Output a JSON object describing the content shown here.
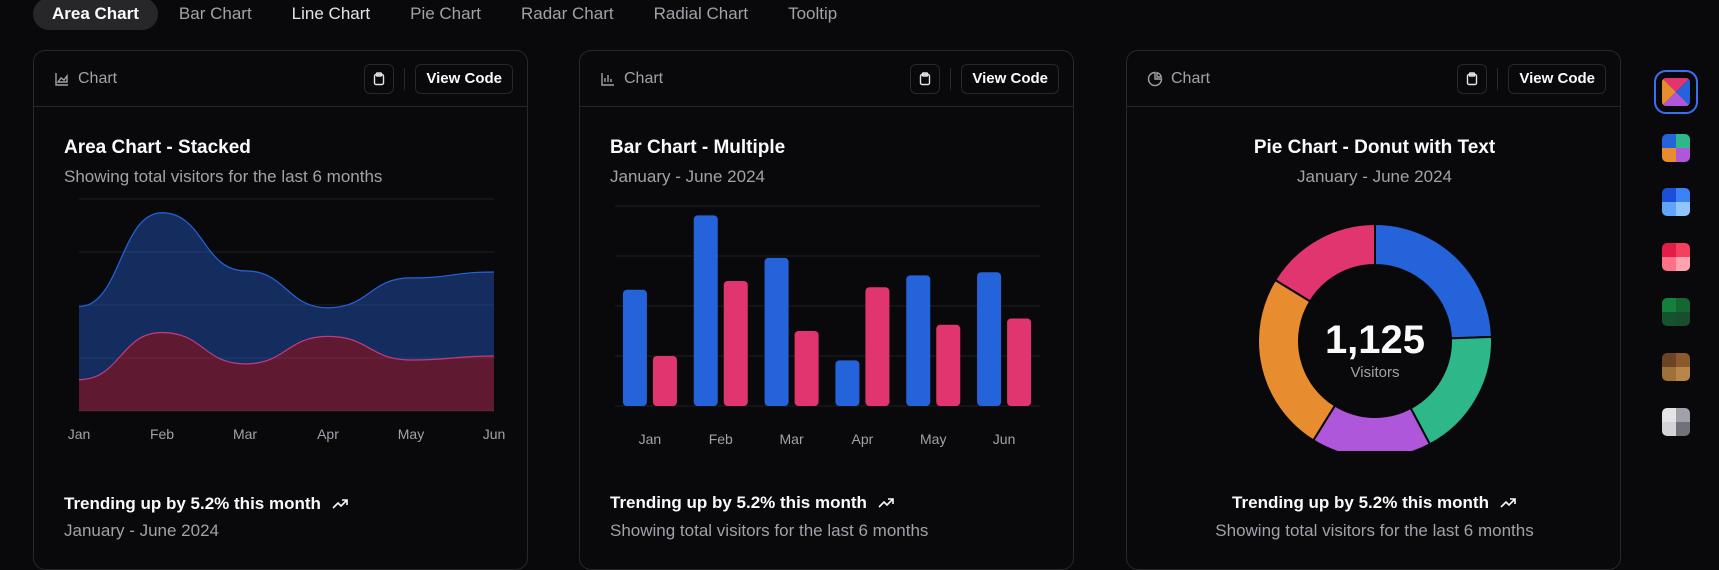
{
  "tabs": [
    {
      "label": "Area Chart",
      "active": true
    },
    {
      "label": "Bar Chart",
      "active": false
    },
    {
      "label": "Line Chart",
      "active": false
    },
    {
      "label": "Pie Chart",
      "active": false
    },
    {
      "label": "Radar Chart",
      "active": false
    },
    {
      "label": "Radial Chart",
      "active": false
    },
    {
      "label": "Tooltip",
      "active": false
    }
  ],
  "cards": [
    {
      "header_label": "Chart",
      "view_code_label": "View Code",
      "title": "Area Chart - Stacked",
      "subtitle": "Showing total visitors for the last 6 months",
      "footer_main": "Trending up by 5.2% this month",
      "footer_sub": "January - June 2024"
    },
    {
      "header_label": "Chart",
      "view_code_label": "View Code",
      "title": "Bar Chart - Multiple",
      "subtitle": "January - June 2024",
      "footer_main": "Trending up by 5.2% this month",
      "footer_sub": "Showing total visitors for the last 6 months"
    },
    {
      "header_label": "Chart",
      "view_code_label": "View Code",
      "title": "Pie Chart - Donut with Text",
      "subtitle": "January - June 2024",
      "footer_main": "Trending up by 5.2% this month",
      "footer_sub": "Showing total visitors for the last 6 months"
    }
  ],
  "colors": {
    "blue": "#2563db",
    "pink": "#e0356e",
    "green": "#2eb88a",
    "purple": "#af57db",
    "orange": "#e88c30"
  },
  "palette_swatches": [
    {
      "name": "mixed",
      "selected": true,
      "colors": [
        "#e0356e",
        "#2563db",
        "#e88c30",
        "#af57db"
      ]
    },
    {
      "name": "default",
      "selected": false,
      "colors": [
        "#2563db",
        "#2eb88a",
        "#e88c30",
        "#af57db"
      ]
    },
    {
      "name": "blue",
      "selected": false,
      "colors": [
        "#1d4ed8",
        "#3b82f6",
        "#60a5fa",
        "#93c5fd"
      ]
    },
    {
      "name": "rose",
      "selected": false,
      "colors": [
        "#e11d48",
        "#f43f5e",
        "#fb7185",
        "#fda4af"
      ]
    },
    {
      "name": "green",
      "selected": false,
      "colors": [
        "#15803d",
        "#166534",
        "#14532d",
        "#1a4d2e"
      ]
    },
    {
      "name": "brown",
      "selected": false,
      "colors": [
        "#6b4423",
        "#8b5a2b",
        "#a0703a",
        "#b8864b"
      ]
    },
    {
      "name": "neutral",
      "selected": false,
      "colors": [
        "#e4e4e7",
        "#a1a1aa",
        "#d4d4d8",
        "#71717a"
      ]
    }
  ],
  "chart_data": [
    {
      "type": "area",
      "title": "Area Chart - Stacked",
      "categories": [
        "Jan",
        "Feb",
        "Mar",
        "Apr",
        "May",
        "Jun"
      ],
      "series": [
        {
          "name": "",
          "color": "#e0356e",
          "values": [
            80,
            200,
            120,
            190,
            130,
            140
          ]
        },
        {
          "name": "",
          "color": "#2563db",
          "values": [
            186,
            305,
            237,
            73,
            209,
            214
          ]
        }
      ],
      "stacked": true,
      "ylim": [
        0,
        540
      ],
      "grid": true
    },
    {
      "type": "bar",
      "title": "Bar Chart - Multiple",
      "categories": [
        "Jan",
        "Feb",
        "Mar",
        "Apr",
        "May",
        "Jun"
      ],
      "series": [
        {
          "name": "",
          "color": "#2563db",
          "values": [
            186,
            305,
            237,
            73,
            209,
            214
          ]
        },
        {
          "name": "",
          "color": "#e0356e",
          "values": [
            80,
            200,
            120,
            190,
            130,
            140
          ]
        }
      ],
      "ylim": [
        0,
        320
      ],
      "grid": true
    },
    {
      "type": "pie",
      "title": "Pie Chart - Donut with Text",
      "donut": true,
      "center_value": "1,125",
      "center_label": "Visitors",
      "slices": [
        {
          "name": "",
          "value": 275,
          "color": "#2563db"
        },
        {
          "name": "",
          "value": 200,
          "color": "#2eb88a"
        },
        {
          "name": "",
          "value": 187,
          "color": "#af57db"
        },
        {
          "name": "",
          "value": 280,
          "color": "#e88c30"
        },
        {
          "name": "",
          "value": 183,
          "color": "#e0356e"
        }
      ]
    }
  ]
}
